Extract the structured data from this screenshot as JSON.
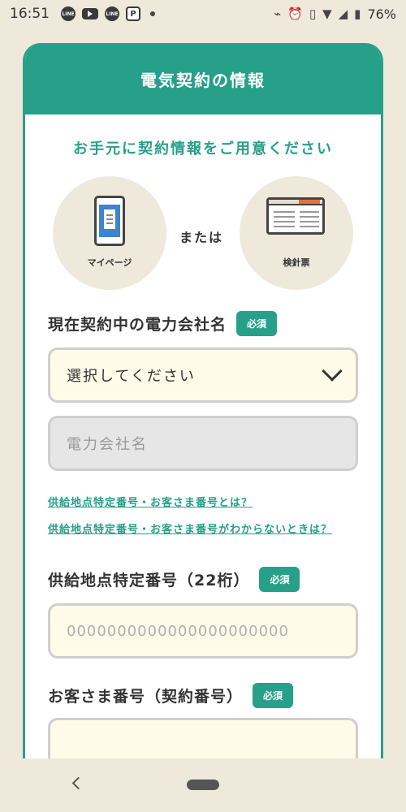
{
  "status_bar": {
    "time": "16:51",
    "apps": [
      "LINE",
      "YouTube",
      "LINE",
      "Parking"
    ],
    "battery": "76%"
  },
  "card": {
    "title": "電気契約の情報",
    "prepare_text": "お手元に契約情報をご用意ください",
    "option_left": "マイページ",
    "or_text": "または",
    "option_right": "検針票"
  },
  "company": {
    "label": "現在契約中の電力会社名",
    "required_badge": "必須",
    "select_value": "選択してください",
    "input_placeholder": "電力会社名"
  },
  "links": {
    "what_is": "供給地点特定番号・お客さま番号とは？",
    "unknown": "供給地点特定番号・お客さま番号がわからないときは？"
  },
  "supply_point": {
    "label": "供給地点特定番号（22桁）",
    "required_badge": "必須",
    "placeholder": "0000000000000000000000"
  },
  "customer_number": {
    "label": "お客さま番号（契約番号）",
    "required_badge": "必須"
  },
  "colors": {
    "accent": "#27a08a",
    "background": "#efe9dc",
    "input_cream": "#fffbe8"
  }
}
